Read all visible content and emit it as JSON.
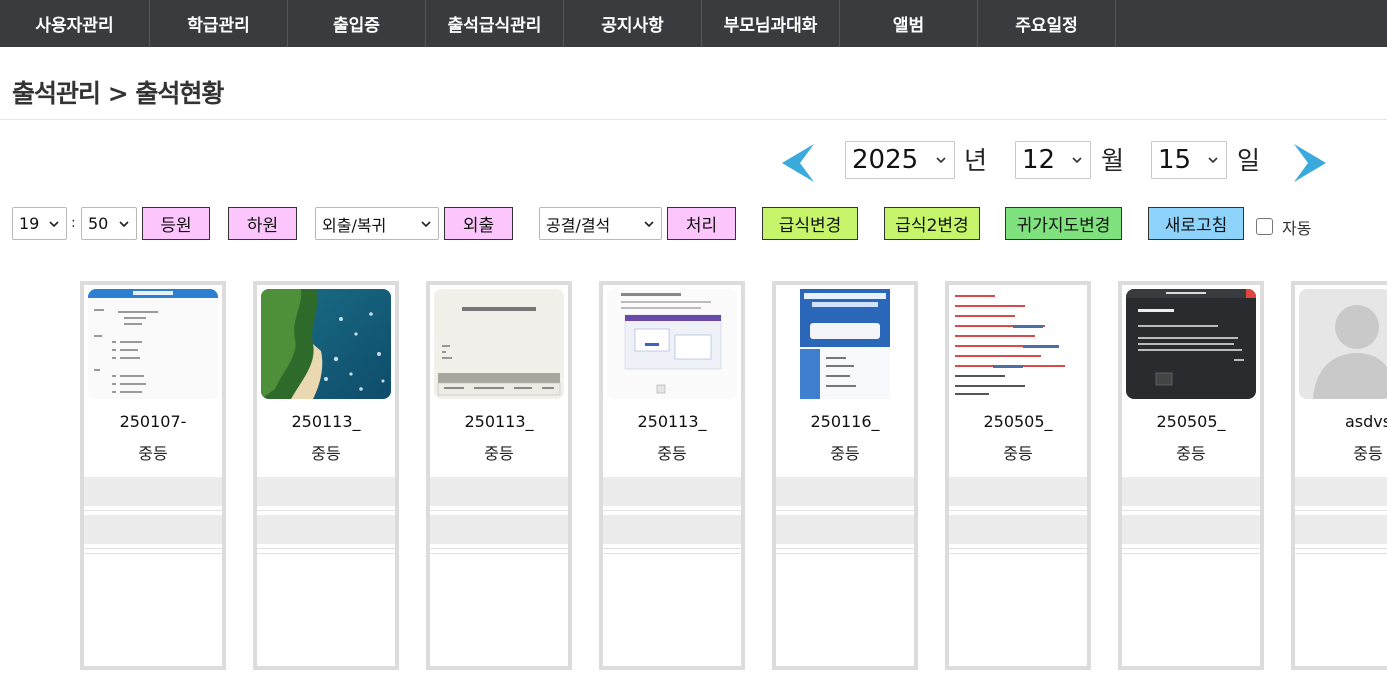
{
  "nav": {
    "items": [
      {
        "label": "사용자관리"
      },
      {
        "label": "학급관리"
      },
      {
        "label": "출입증"
      },
      {
        "label": "출석급식관리"
      },
      {
        "label": "공지사항"
      },
      {
        "label": "부모님과대화"
      },
      {
        "label": "앨범"
      },
      {
        "label": "주요일정"
      }
    ]
  },
  "title": "출석관리 > 출석현황",
  "date": {
    "year": "2025",
    "year_unit": "년",
    "month": "12",
    "month_unit": "월",
    "day": "15",
    "day_unit": "일"
  },
  "controls": {
    "hour": "19",
    "minute": "50",
    "checkin_label": "등원",
    "checkout_label": "하원",
    "outing_select": "외출/복귀",
    "outing_label": "외출",
    "absence_select": "공결/결석",
    "process_label": "처리",
    "meal_change_label": "급식변경",
    "meal2_change_label": "급식2변경",
    "guidance_change_label": "귀가지도변경",
    "refresh_label": "새로고침",
    "auto_label": "자동",
    "auto_checked": false
  },
  "colors": {
    "nav_bg": "#3a3b3f",
    "arrow": "#3aa9dc",
    "pink_button": "#fcc6fc",
    "lime_button": "#c6f56b",
    "green_button": "#7fe27f",
    "blue_button": "#8ed3fb"
  },
  "cards": [
    {
      "name": "250107-",
      "level": "중등",
      "thumb": "document-screenshot"
    },
    {
      "name": "250113_",
      "level": "중등",
      "thumb": "coast-photo"
    },
    {
      "name": "250113_",
      "level": "중등",
      "thumb": "form-screenshot"
    },
    {
      "name": "250113_",
      "level": "중등",
      "thumb": "web-screenshot"
    },
    {
      "name": "250116_",
      "level": "중등",
      "thumb": "aircon-ad"
    },
    {
      "name": "250505_",
      "level": "중등",
      "thumb": "text-screenshot"
    },
    {
      "name": "250505_",
      "level": "중등",
      "thumb": "dialog-screenshot"
    },
    {
      "name": "asdvs",
      "level": "중등",
      "thumb": "default-avatar"
    }
  ]
}
